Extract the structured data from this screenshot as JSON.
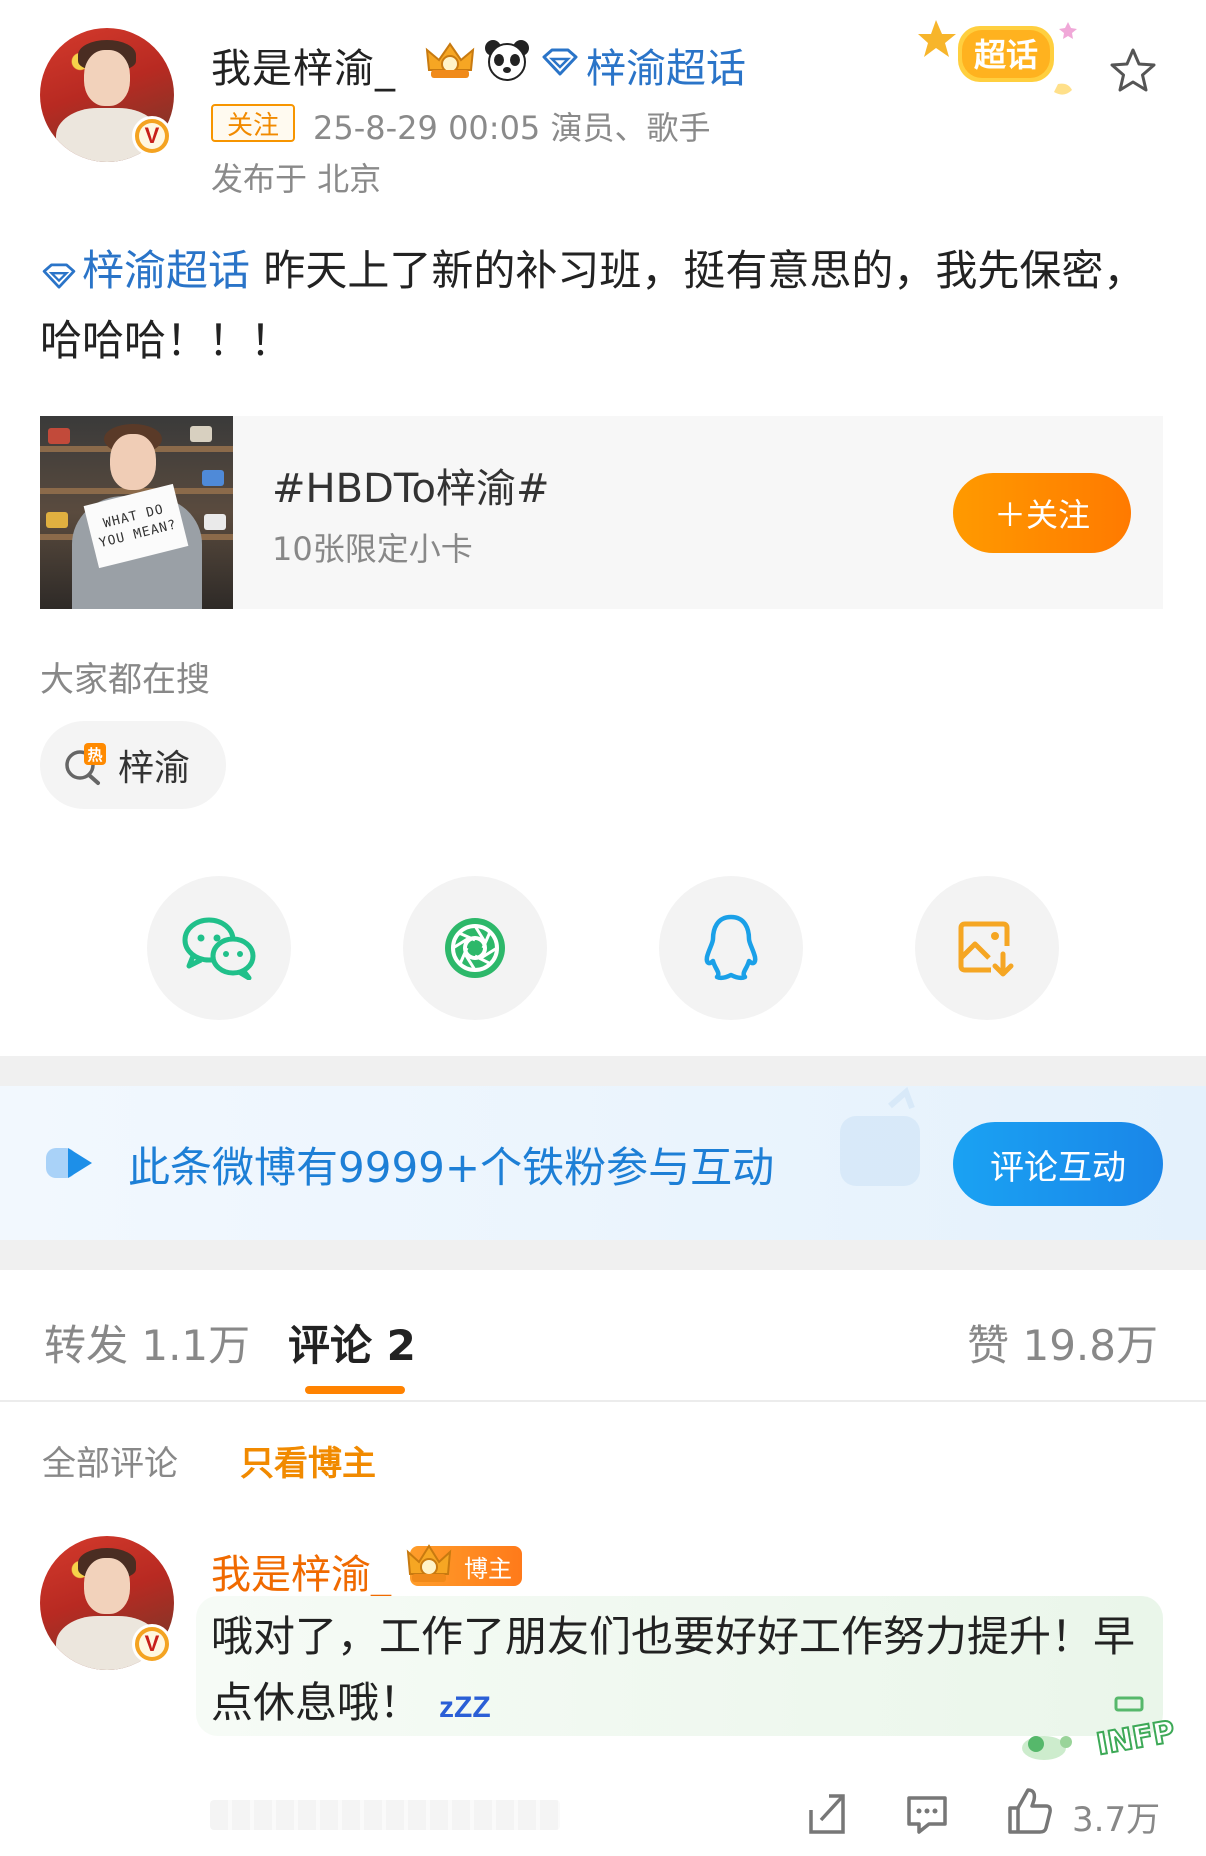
{
  "post": {
    "username": "我是梓渝_",
    "supertopic": "梓渝超话",
    "follow_tag": "关注",
    "time_role": "25-8-29 00:05  演员、歌手",
    "location": "发布于 北京",
    "sticker_text": "超话",
    "verified_mark": "V",
    "body_topic": "梓渝超话",
    "body_text": " 昨天上了新的补习班，挺有意思的，我先保密，哈哈哈！！！"
  },
  "topic_card": {
    "title": "#HBDTo梓渝#",
    "subtitle": "10张限定小卡",
    "follow_button": "＋关注",
    "thumb_sign": "WHAT DO YOU MEAN?"
  },
  "search": {
    "heading": "大家都在搜",
    "chip_label": "梓渝",
    "chip_hot_mark": "热"
  },
  "share": {
    "icons": [
      "wechat-icon",
      "moments-icon",
      "qq-icon",
      "save-image-icon"
    ]
  },
  "fan_banner": {
    "text": "此条微博有9999+个铁粉参与互动",
    "button": "评论互动"
  },
  "tabs": {
    "repost": "转发 1.1万",
    "comment": "评论 2",
    "likes": "赞 19.8万"
  },
  "filters": {
    "all": "全部评论",
    "op_only": "只看博主"
  },
  "comment": {
    "username": "我是梓渝_",
    "op_badge": "博主",
    "text": "哦对了，工作了朋友们也要好好工作努力提升！早点休息哦！",
    "zzz": "zZZ",
    "sticker_text": "INFP",
    "like_count": "3.7万"
  },
  "colors": {
    "accent_orange": "#ff8200",
    "link_blue": "#2a74c8",
    "banner_blue": "#1d7fd6",
    "wechat_green": "#20c08a",
    "qq_blue": "#1aa0e8",
    "save_orange": "#f5a623"
  }
}
